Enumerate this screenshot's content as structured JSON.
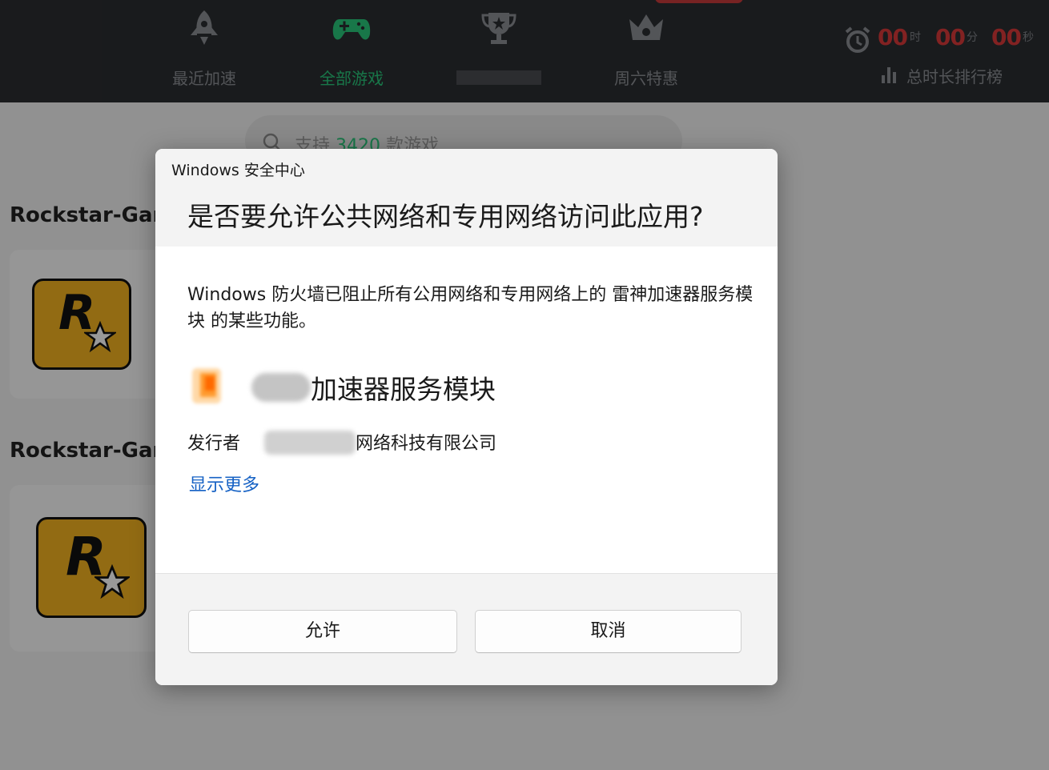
{
  "nav": {
    "items": [
      {
        "label": "最近加速",
        "icon": "rocket-icon"
      },
      {
        "label": "全部游戏",
        "icon": "gamepad-icon"
      },
      {
        "label": "",
        "icon": "trophy-icon"
      },
      {
        "label": "周六特惠",
        "icon": "crown-icon"
      }
    ],
    "active_index": 1
  },
  "timer": {
    "hours": "00",
    "hours_unit": "时",
    "minutes": "00",
    "minutes_unit": "分",
    "seconds": "00",
    "seconds_unit": "秒"
  },
  "ranking": {
    "label": "总时长排行榜"
  },
  "search": {
    "prefix": "支持 ",
    "count": "3420",
    "suffix": " 款游戏"
  },
  "sections": [
    {
      "title": "Rockstar-Gan"
    },
    {
      "title": "Rockstar-Gan"
    }
  ],
  "game_logo": {
    "letter": "R"
  },
  "dialog": {
    "app_title": "Windows 安全中心",
    "title": "是否要允许公共网络和专用网络访问此应用?",
    "message": "Windows 防火墙已阻止所有公用网络和专用网络上的 雷神加速器服务模块 的某些功能。",
    "app_name": "加速器服务模块",
    "publisher_label": "发行者",
    "publisher": "网络科技有限公司",
    "show_more": "显示更多",
    "allow_label": "允许",
    "cancel_label": "取消"
  },
  "colors": {
    "accent_green": "#29c77a",
    "timer_red": "#d93a3a",
    "link_blue": "#1561c4",
    "rockstar_yellow": "#f4b221"
  }
}
